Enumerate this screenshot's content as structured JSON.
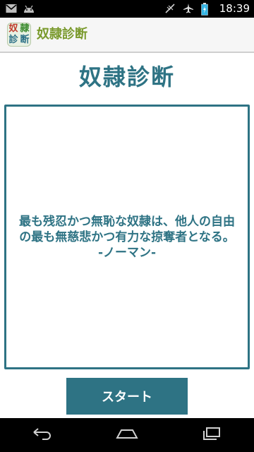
{
  "status_bar": {
    "time": "18:39",
    "icons": [
      "gmail-icon",
      "android-icon",
      "signal-off-icon",
      "airplane-icon",
      "battery-charging-icon"
    ]
  },
  "action_bar": {
    "app_icon_chars": [
      "奴",
      "隷",
      "診",
      "断"
    ],
    "title": "奴隷診断"
  },
  "main": {
    "heading": "奴隷診断",
    "quote": "最も残忍かつ無恥な奴隷は、他人の自由の最も無慈悲かつ有力な掠奪者となる。",
    "author": "-ノーマン-",
    "start_label": "スタート"
  },
  "colors": {
    "accent": "#2e7384",
    "title_green": "#7a9a2d"
  },
  "nav_bar": {
    "icons": [
      "back-icon",
      "home-icon",
      "recents-icon"
    ]
  }
}
